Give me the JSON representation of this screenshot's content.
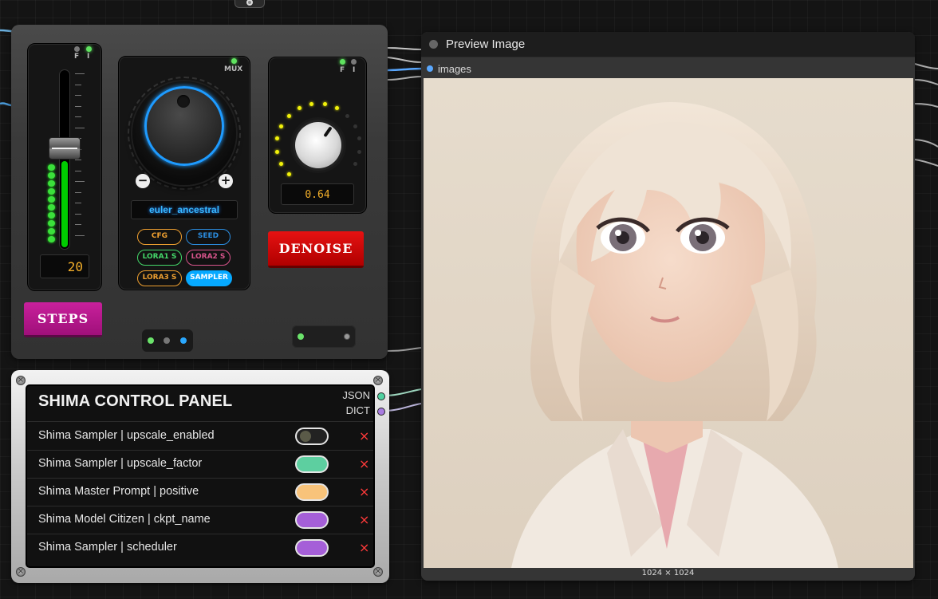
{
  "top_node": {
    "icon": "circle-dot-icon"
  },
  "steps_panel": {
    "f_label": "F",
    "i_label": "I",
    "value": "20",
    "button_label": "STEPS",
    "button_color": "#c9209c",
    "level": 0.49
  },
  "mux_panel": {
    "label": "MUX",
    "sampler_value": "euler_ancestral",
    "minus_label": "−",
    "plus_label": "+",
    "accent": "#1e9bff",
    "pills": [
      {
        "label": "CFG",
        "color": "#f0a030"
      },
      {
        "label": "SEED",
        "color": "#2b8de0"
      },
      {
        "label": "LORA1 S",
        "color": "#44d96a"
      },
      {
        "label": "LORA2 S",
        "color": "#d9548c"
      },
      {
        "label": "LORA3 S",
        "color": "#f0a030"
      },
      {
        "label": "SAMPLER",
        "color": "#00aaff"
      }
    ]
  },
  "denoise_panel": {
    "f_label": "F",
    "i_label": "I",
    "value": "0.64",
    "button_label": "DENOISE",
    "button_color": "#e61212"
  },
  "shima_panel": {
    "title": "SHIMA CONTROL PANEL",
    "outputs": [
      {
        "label": "JSON",
        "color": "#4fd1a0"
      },
      {
        "label": "DICT",
        "color": "#a87be0"
      }
    ],
    "rows": [
      {
        "label": "Shima Sampler | upscale_enabled",
        "color": "#222222",
        "enabled": false
      },
      {
        "label": "Shima Sampler | upscale_factor",
        "color": "#5dcfa0",
        "enabled": true
      },
      {
        "label": "Shima Master Prompt | positive",
        "color": "#f8c37a",
        "enabled": true
      },
      {
        "label": "Shima Model Citizen | ckpt_name",
        "color": "#a55fd8",
        "enabled": true
      },
      {
        "label": "Shima Sampler | scheduler",
        "color": "#a55fd8",
        "enabled": true
      }
    ],
    "remove_icon": "×"
  },
  "preview_node": {
    "title": "Preview Image",
    "input_label": "images",
    "dimensions": "1024 × 1024"
  }
}
